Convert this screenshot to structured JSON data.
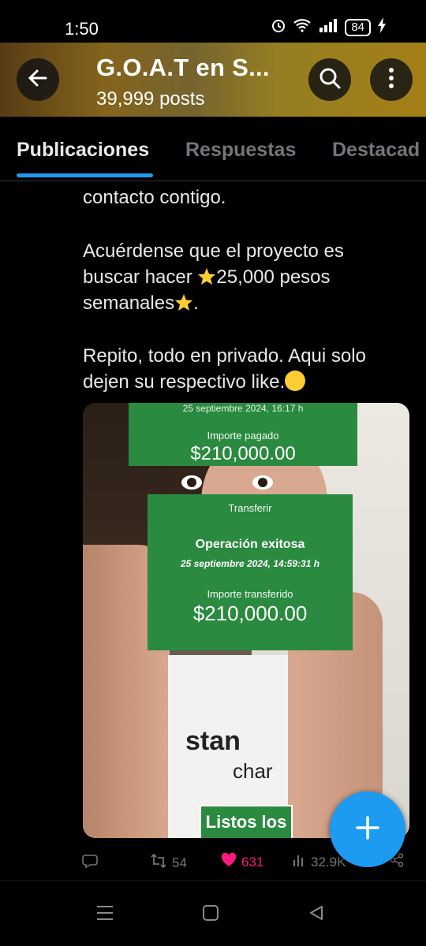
{
  "status_bar": {
    "time": "1:50",
    "battery": "84"
  },
  "header": {
    "title": "G.O.A.T en S...",
    "subtitle": "39,999 posts"
  },
  "tabs": [
    {
      "label": "Publicaciones",
      "active": true
    },
    {
      "label": "Respuestas",
      "active": false
    },
    {
      "label": "Destacad",
      "active": false
    }
  ],
  "post": {
    "lines": {
      "l1": "contacto contigo.",
      "l2": "Acuérdense que el proyecto es",
      "l3a": "buscar hacer ",
      "l3b": "25,000 pesos",
      "l4": "semanales",
      "l4end": ".",
      "l5": "Repito, todo en privado. Aqui solo",
      "l6": "dejen su respectivo like."
    },
    "media": {
      "card_top": {
        "date": "25 septiembre 2024, 16:17 h",
        "label": "Importe pagado",
        "amount": "$210,000.00"
      },
      "card_main": {
        "header": "Transferir",
        "title": "Operación exitosa",
        "date": "25 septiembre 2024, 14:59:31 h",
        "label": "Importe transferido",
        "amount": "$210,000.00"
      },
      "overlay_text": "Listos los",
      "shirt_text_1": "stan",
      "shirt_text_2": "char"
    },
    "actions": {
      "retweets": "54",
      "likes": "631",
      "views": "32.9K"
    }
  },
  "colors": {
    "accent": "#1d9bf0",
    "like": "#f91880",
    "card_green": "#2a8a3f"
  }
}
